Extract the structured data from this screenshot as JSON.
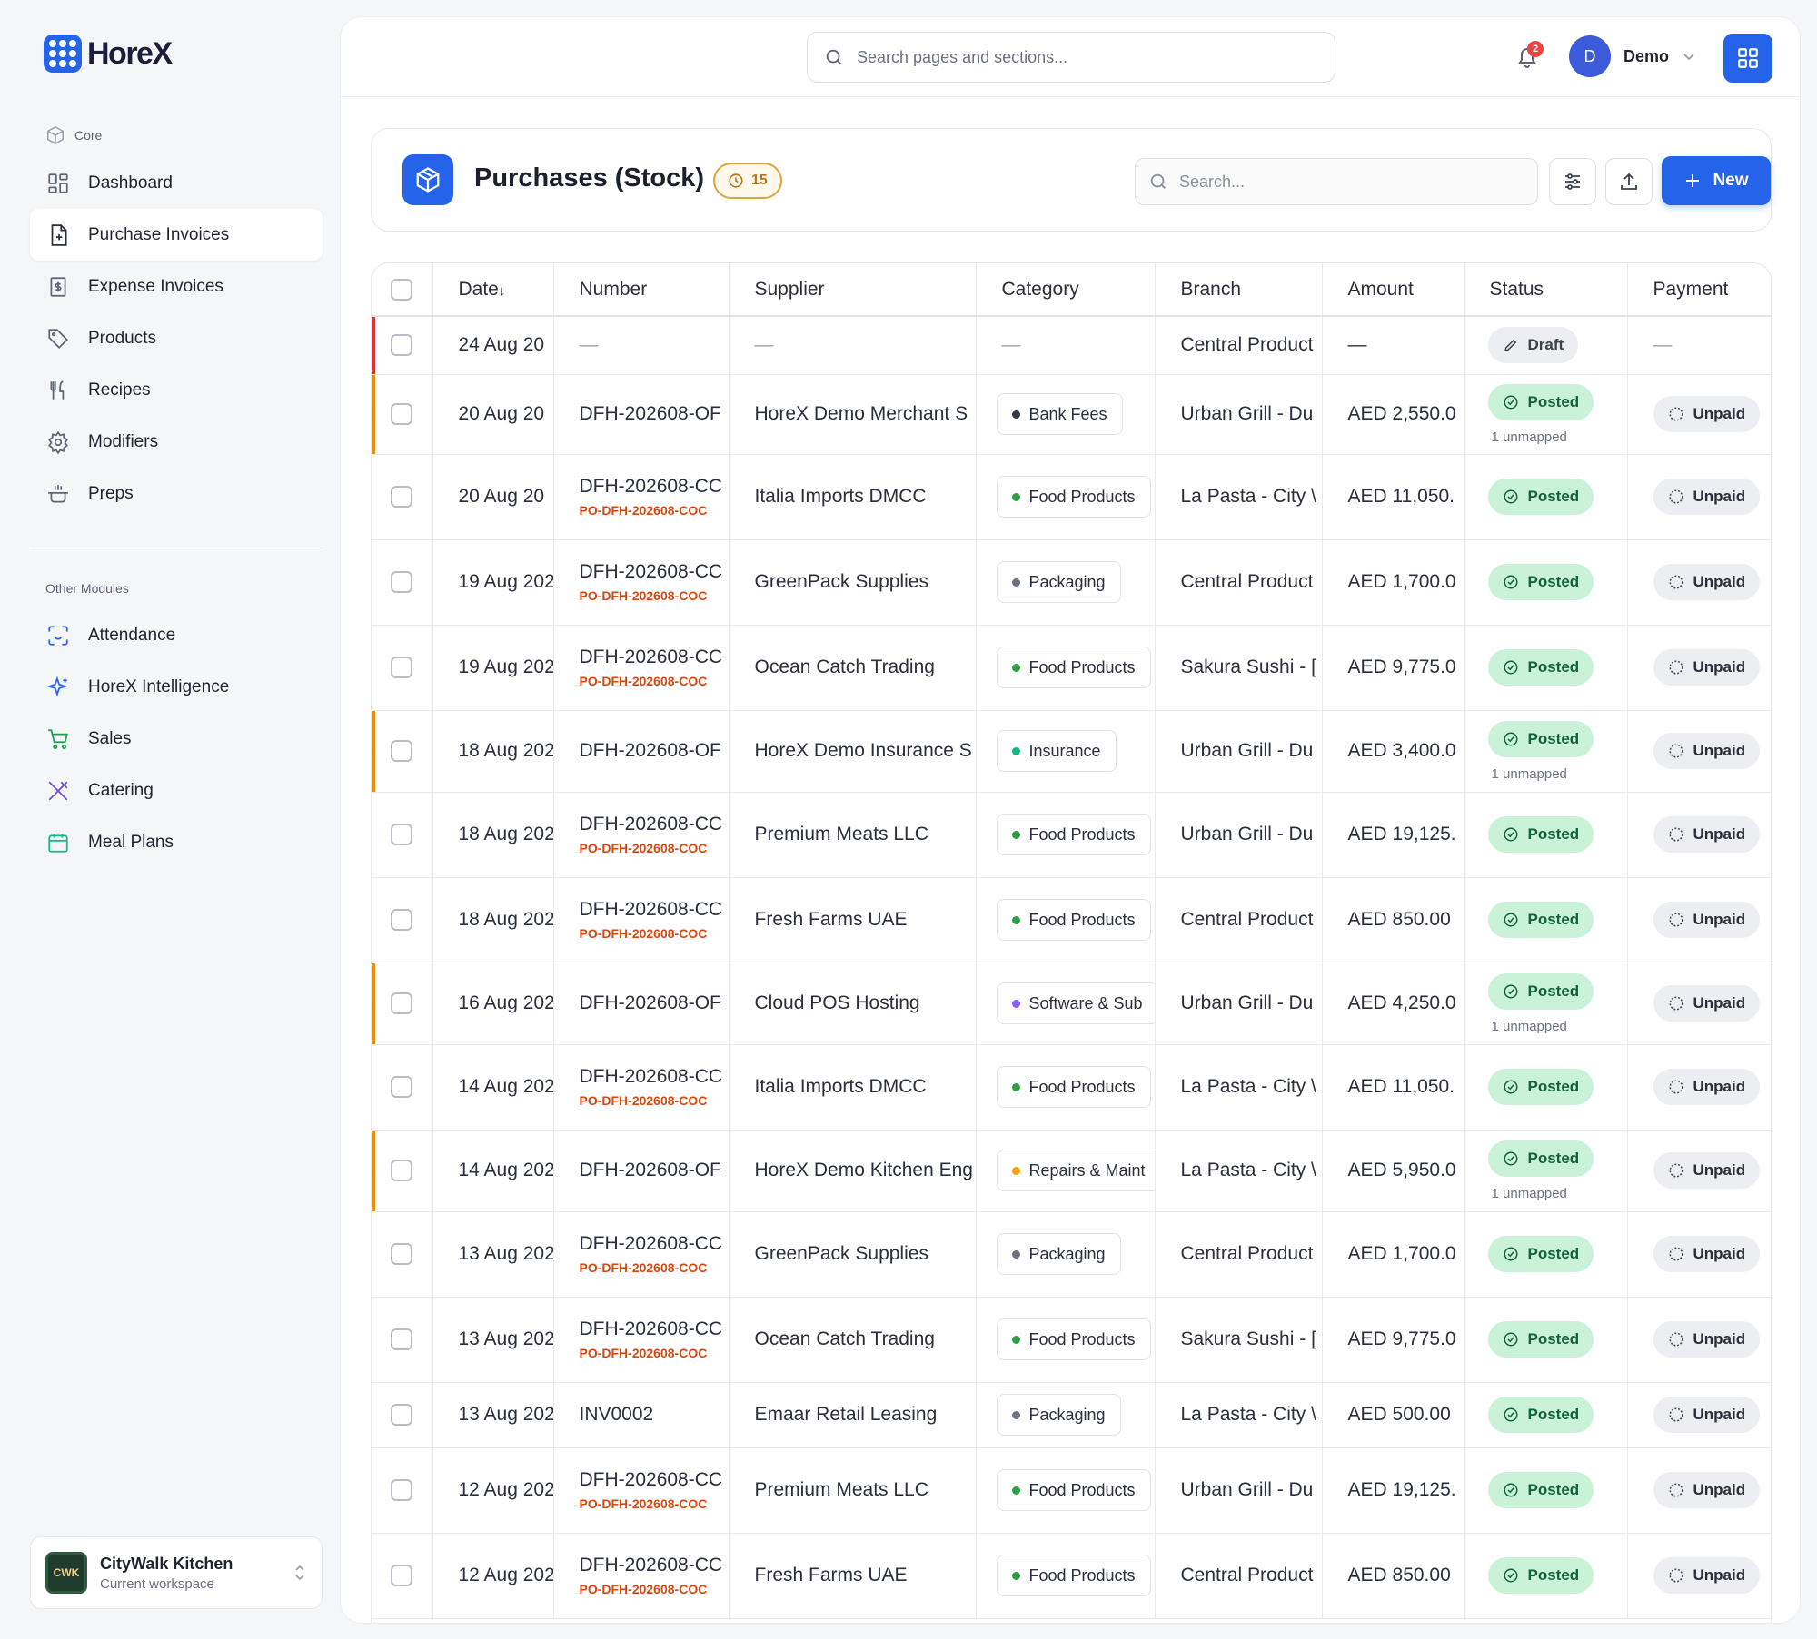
{
  "app": {
    "logo": "HoreX"
  },
  "sidebar": {
    "core_label": "Core",
    "core_items": [
      {
        "label": "Dashboard",
        "icon": "dashboard-icon"
      },
      {
        "label": "Purchase Invoices",
        "icon": "file-plus-icon",
        "active": true
      },
      {
        "label": "Expense Invoices",
        "icon": "receipt-icon"
      },
      {
        "label": "Products",
        "icon": "tag-icon"
      },
      {
        "label": "Recipes",
        "icon": "utensils-icon"
      },
      {
        "label": "Modifiers",
        "icon": "gear-icon"
      },
      {
        "label": "Preps",
        "icon": "cooking-pot-icon"
      }
    ],
    "other_label": "Other Modules",
    "other_items": [
      {
        "label": "Attendance",
        "icon": "scan-face-icon"
      },
      {
        "label": "HoreX Intelligence",
        "icon": "sparkles-icon"
      },
      {
        "label": "Sales",
        "icon": "cart-icon"
      },
      {
        "label": "Catering",
        "icon": "crossed-utensils-icon"
      },
      {
        "label": "Meal Plans",
        "icon": "calendar-icon"
      }
    ],
    "workspace": {
      "name": "CityWalk Kitchen",
      "subtitle": "Current workspace",
      "logo_text": "CWK"
    }
  },
  "topbar": {
    "search_placeholder": "Search pages and sections...",
    "notification_count": "2",
    "user_initial": "D",
    "user_name": "Demo"
  },
  "page": {
    "title": "Purchases (Stock)",
    "count": "15",
    "search_placeholder": "Search...",
    "new_label": "New"
  },
  "table": {
    "columns": [
      "Date",
      "Number",
      "Supplier",
      "Category",
      "Branch",
      "Amount",
      "Status",
      "Payment"
    ],
    "sort_indicator": "↓",
    "rows": [
      {
        "date": "24 Aug 20",
        "number": "—",
        "sub": "",
        "supplier": "—",
        "category": "—",
        "cat_color": "",
        "branch": "Central Product",
        "amount": "—",
        "status": "Draft",
        "unmapped": "",
        "payment": "—",
        "flag": "#e03131"
      },
      {
        "date": "20 Aug 20",
        "number": "DFH-202608-OF",
        "sub": "",
        "supplier": "HoreX Demo Merchant S",
        "category": "Bank Fees",
        "cat_color": "#343a40",
        "branch": "Urban Grill - Du",
        "amount": "AED 2,550.0",
        "status": "Posted",
        "unmapped": "1 unmapped",
        "payment": "Unpaid",
        "flag": "#f08c00"
      },
      {
        "date": "20 Aug 20",
        "number": "DFH-202608-CC",
        "sub": "PO-DFH-202608-COC",
        "supplier": "Italia Imports DMCC",
        "category": "Food Products",
        "cat_color": "#2f9e44",
        "branch": "La Pasta - City \\",
        "amount": "AED 11,050.",
        "status": "Posted",
        "unmapped": "",
        "payment": "Unpaid",
        "flag": ""
      },
      {
        "date": "19 Aug 202",
        "number": "DFH-202608-CC",
        "sub": "PO-DFH-202608-COC",
        "supplier": "GreenPack Supplies",
        "category": "Packaging",
        "cat_color": "#6b7280",
        "branch": "Central Product",
        "amount": "AED 1,700.0",
        "status": "Posted",
        "unmapped": "",
        "payment": "Unpaid",
        "flag": ""
      },
      {
        "date": "19 Aug 202",
        "number": "DFH-202608-CC",
        "sub": "PO-DFH-202608-COC",
        "supplier": "Ocean Catch Trading",
        "category": "Food Products",
        "cat_color": "#2f9e44",
        "branch": "Sakura Sushi - [",
        "amount": "AED 9,775.0",
        "status": "Posted",
        "unmapped": "",
        "payment": "Unpaid",
        "flag": ""
      },
      {
        "date": "18 Aug 202",
        "number": "DFH-202608-OF",
        "sub": "",
        "supplier": "HoreX Demo Insurance S",
        "category": "Insurance",
        "cat_color": "#12b886",
        "branch": "Urban Grill - Du",
        "amount": "AED 3,400.0",
        "status": "Posted",
        "unmapped": "1 unmapped",
        "payment": "Unpaid",
        "flag": "#f08c00"
      },
      {
        "date": "18 Aug 202",
        "number": "DFH-202608-CC",
        "sub": "PO-DFH-202608-COC",
        "supplier": "Premium Meats LLC",
        "category": "Food Products",
        "cat_color": "#2f9e44",
        "branch": "Urban Grill - Du",
        "amount": "AED 19,125.",
        "status": "Posted",
        "unmapped": "",
        "payment": "Unpaid",
        "flag": ""
      },
      {
        "date": "18 Aug 202",
        "number": "DFH-202608-CC",
        "sub": "PO-DFH-202608-COC",
        "supplier": "Fresh Farms UAE",
        "category": "Food Products",
        "cat_color": "#2f9e44",
        "branch": "Central Product",
        "amount": "AED 850.00",
        "status": "Posted",
        "unmapped": "",
        "payment": "Unpaid",
        "flag": ""
      },
      {
        "date": "16 Aug 202",
        "number": "DFH-202608-OF",
        "sub": "",
        "supplier": "Cloud POS Hosting",
        "category": "Software & Sub",
        "cat_color": "#845ef7",
        "branch": "Urban Grill - Du",
        "amount": "AED 4,250.0",
        "status": "Posted",
        "unmapped": "1 unmapped",
        "payment": "Unpaid",
        "flag": "#f08c00"
      },
      {
        "date": "14 Aug 202",
        "number": "DFH-202608-CC",
        "sub": "PO-DFH-202608-COC",
        "supplier": "Italia Imports DMCC",
        "category": "Food Products",
        "cat_color": "#2f9e44",
        "branch": "La Pasta - City \\",
        "amount": "AED 11,050.",
        "status": "Posted",
        "unmapped": "",
        "payment": "Unpaid",
        "flag": ""
      },
      {
        "date": "14 Aug 202",
        "number": "DFH-202608-OF",
        "sub": "",
        "supplier": "HoreX Demo Kitchen Eng",
        "category": "Repairs & Maint",
        "cat_color": "#f59f00",
        "branch": "La Pasta - City \\",
        "amount": "AED 5,950.0",
        "status": "Posted",
        "unmapped": "1 unmapped",
        "payment": "Unpaid",
        "flag": "#f08c00"
      },
      {
        "date": "13 Aug 202",
        "number": "DFH-202608-CC",
        "sub": "PO-DFH-202608-COC",
        "supplier": "GreenPack Supplies",
        "category": "Packaging",
        "cat_color": "#6b7280",
        "branch": "Central Product",
        "amount": "AED 1,700.0",
        "status": "Posted",
        "unmapped": "",
        "payment": "Unpaid",
        "flag": ""
      },
      {
        "date": "13 Aug 202",
        "number": "DFH-202608-CC",
        "sub": "PO-DFH-202608-COC",
        "supplier": "Ocean Catch Trading",
        "category": "Food Products",
        "cat_color": "#2f9e44",
        "branch": "Sakura Sushi - [",
        "amount": "AED 9,775.0",
        "status": "Posted",
        "unmapped": "",
        "payment": "Unpaid",
        "flag": ""
      },
      {
        "date": "13 Aug 202",
        "number": "INV0002",
        "sub": "",
        "supplier": "Emaar Retail Leasing",
        "category": "Packaging",
        "cat_color": "#6b7280",
        "branch": "La Pasta - City \\",
        "amount": "AED 500.00",
        "status": "Posted",
        "unmapped": "",
        "payment": "Unpaid",
        "flag": ""
      },
      {
        "date": "12 Aug 202",
        "number": "DFH-202608-CC",
        "sub": "PO-DFH-202608-COC",
        "supplier": "Premium Meats LLC",
        "category": "Food Products",
        "cat_color": "#2f9e44",
        "branch": "Urban Grill - Du",
        "amount": "AED 19,125.",
        "status": "Posted",
        "unmapped": "",
        "payment": "Unpaid",
        "flag": ""
      },
      {
        "date": "12 Aug 202",
        "number": "DFH-202608-CC",
        "sub": "PO-DFH-202608-COC",
        "supplier": "Fresh Farms UAE",
        "category": "Food Products",
        "cat_color": "#2f9e44",
        "branch": "Central Product",
        "amount": "AED 850.00",
        "status": "Posted",
        "unmapped": "",
        "payment": "Unpaid",
        "flag": ""
      }
    ]
  }
}
